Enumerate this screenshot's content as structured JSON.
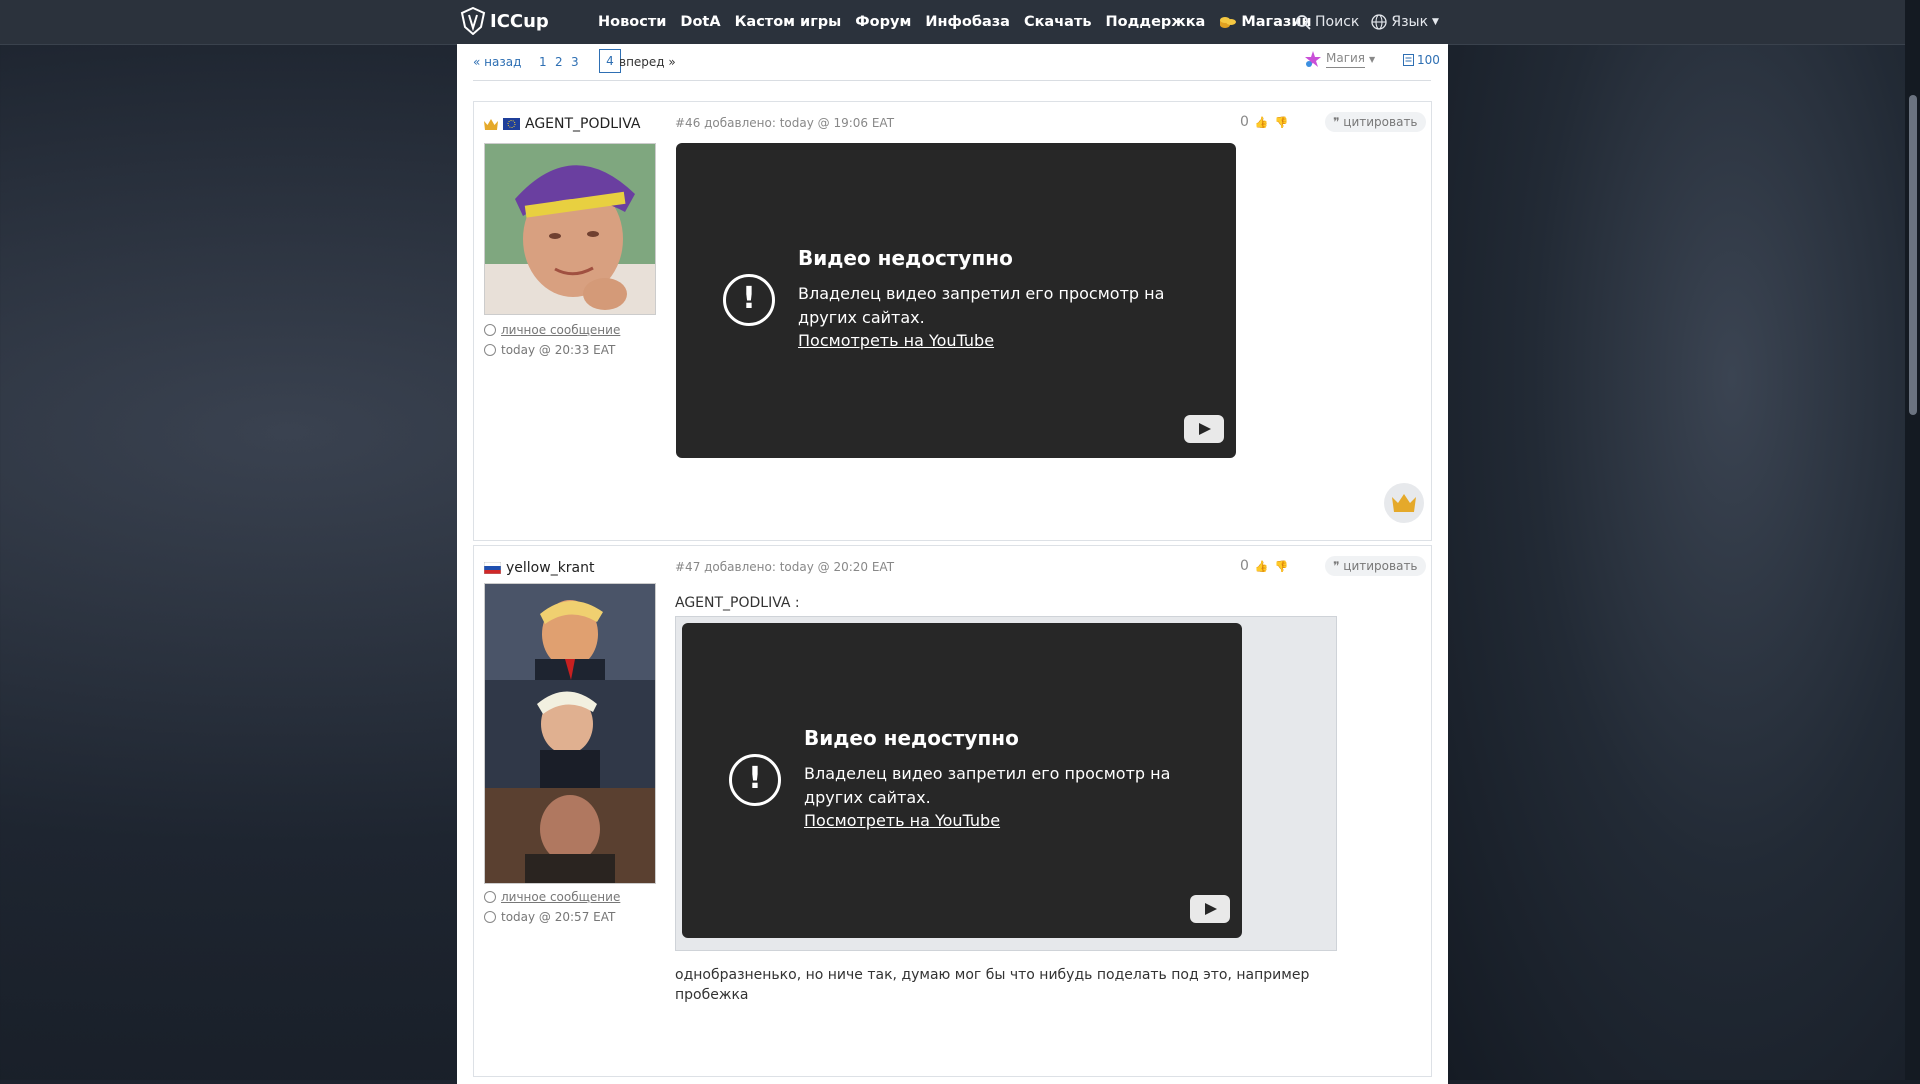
{
  "navbar": {
    "logo": "ICCup",
    "items": [
      "Новости",
      "DotA",
      "Кастом игры",
      "Форум",
      "Инфобаза",
      "Скачать",
      "Поддержка",
      "Магазин"
    ],
    "search_label": "Поиск",
    "lang_label": "Язык"
  },
  "pager": {
    "back": "« назад",
    "pages": [
      "1",
      "2",
      "3"
    ],
    "current": "4",
    "forward": "вперед »",
    "magic_label": "Магия",
    "count": "100"
  },
  "posts": [
    {
      "username": "AGENT_PODLIVA",
      "header": "#46 добавлено: today @ 19:06 EAT",
      "votes": "0",
      "quote_label": "цитировать",
      "pm_label": "личное сообщение",
      "last_seen": "today @ 20:33 EAT",
      "video": {
        "title": "Видео недоступно",
        "message": "Владелец видео запретил его просмотр на других сайтах.",
        "link": "Посмотреть на YouTube"
      }
    },
    {
      "username": "yellow_krant",
      "header": "#47 добавлено: today @ 20:20 EAT",
      "votes": "0",
      "quote_label": "цитировать",
      "pm_label": "личное сообщение",
      "last_seen": "today @ 20:57 EAT",
      "quoted_author": "AGENT_PODLIVA :",
      "video": {
        "title": "Видео недоступно",
        "message": "Владелец видео запретил его просмотр на других сайтах.",
        "link": "Посмотреть на YouTube"
      },
      "text": "однобразненько, но ниче так, думаю мог бы что нибудь поделать под это, например пробежка"
    }
  ],
  "colors": {
    "navbar": "#2b323c",
    "link": "#2e6fb3",
    "video_bg": "#272727"
  }
}
